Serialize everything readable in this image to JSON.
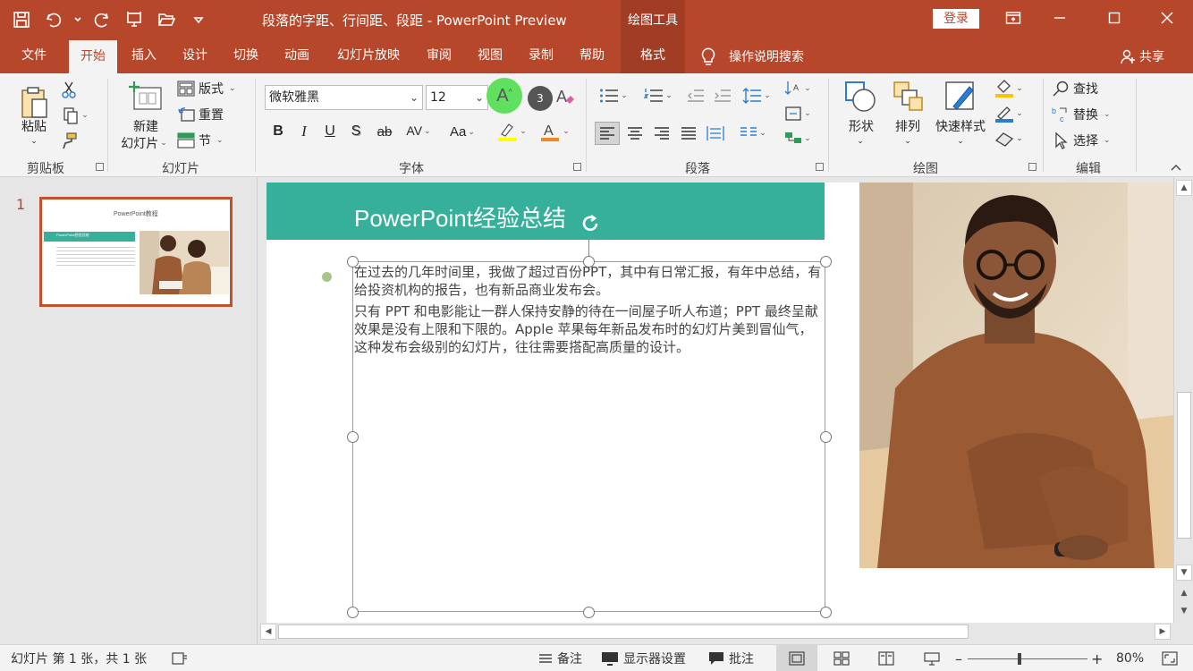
{
  "window": {
    "title": "段落的字距、行间距、段距  -  PowerPoint Preview",
    "context_tab_group": "绘图工具",
    "login_label": "登录"
  },
  "tabs": {
    "file": "文件",
    "home": "开始",
    "insert": "插入",
    "design": "设计",
    "transitions": "切换",
    "animations": "动画",
    "slideshow": "幻灯片放映",
    "review": "审阅",
    "view": "视图",
    "record": "录制",
    "help": "帮助",
    "format": "格式",
    "tell_me": "操作说明搜索",
    "share": "共享"
  },
  "ribbon": {
    "clipboard": {
      "paste": "粘贴",
      "label": "剪贴板"
    },
    "slides": {
      "new_slide_line1": "新建",
      "new_slide_line2": "幻灯片",
      "layout": "版式",
      "reset": "重置",
      "section": "节",
      "label": "幻灯片"
    },
    "font": {
      "font_name": "微软雅黑",
      "font_size": "12",
      "keytip": "3",
      "label": "字体"
    },
    "paragraph": {
      "label": "段落"
    },
    "drawing": {
      "shapes": "形状",
      "arrange": "排列",
      "quick_styles": "快速样式",
      "label": "绘图"
    },
    "editing": {
      "find": "查找",
      "replace": "替换",
      "select": "选择",
      "label": "编辑"
    }
  },
  "colors": {
    "accent": "#b7472a",
    "title_band": "#36b09b",
    "highlight_yellow": "#ffff00",
    "font_color_orange": "#f4851f"
  },
  "thumbnails": {
    "slide_number": "1",
    "thumb_title": "PowerPoint教程",
    "thumb_band": "PowerPoint经验总结"
  },
  "slide": {
    "title": "PowerPoint经验总结",
    "para1": "在过去的几年时间里，我做了超过百份PPT，其中有日常汇报，有年中总结，有给投资机构的报告，也有新品商业发布会。",
    "para2": "只有 PPT 和电影能让一群人保持安静的待在一间屋子听人布道；PPT 最终呈献效果是没有上限和下限的。Apple 苹果每年新品发布时的幻灯片美到冒仙气，这种发布会级别的幻灯片，往往需要搭配高质量的设计。"
  },
  "status": {
    "slide_info": "幻灯片 第 1 张，共 1 张",
    "notes": "备注",
    "display_settings": "显示器设置",
    "comments": "批注",
    "zoom": "80%"
  }
}
